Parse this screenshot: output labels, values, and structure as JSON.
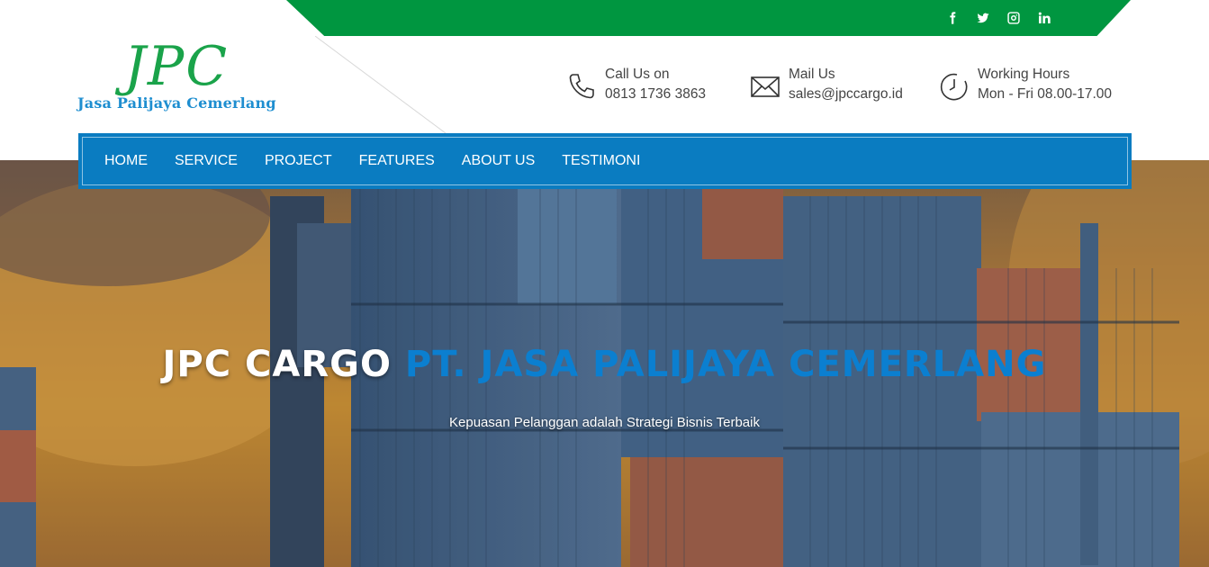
{
  "social": [
    {
      "icon": "facebook-icon"
    },
    {
      "icon": "twitter-icon"
    },
    {
      "icon": "instagram-icon"
    },
    {
      "icon": "linkedin-icon"
    }
  ],
  "logo": {
    "mark": "JPC",
    "subtitle": "Jasa Palijaya Cemerlang"
  },
  "contacts": [
    {
      "icon": "phone-icon",
      "label": "Call Us on",
      "value": "0813 1736 3863"
    },
    {
      "icon": "mail-icon",
      "label": "Mail Us",
      "value": "sales@jpccargo.id"
    },
    {
      "icon": "clock-icon",
      "label": "Working Hours",
      "value": "Mon - Fri 08.00-17.00"
    }
  ],
  "nav": {
    "items": [
      "HOME",
      "SERVICE",
      "PROJECT",
      "FEATURES",
      "ABOUT US",
      "TESTIMONI"
    ]
  },
  "hero": {
    "title_white": "JPC CARGO",
    "title_blue": "PT. JASA PALIJAYA CEMERLANG",
    "subtitle": "Kepuasan Pelanggan adalah Strategi Bisnis Terbaik"
  },
  "colors": {
    "green": "#009640",
    "nav_blue": "#0a7cc1",
    "title_blue": "#0b7fd0",
    "logo_green": "#1aa34a",
    "logo_blue": "#1e8ed0"
  }
}
